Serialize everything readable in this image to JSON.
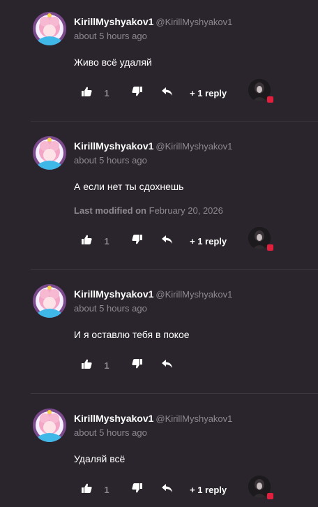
{
  "comments": [
    {
      "author": "KirillMyshyakov1",
      "handle": "@KirillMyshyakov1",
      "time": "about 5 hours ago",
      "text": "Живо всё удаляй",
      "likes": "1",
      "replies_label": "+ 1 reply"
    },
    {
      "author": "KirillMyshyakov1",
      "handle": "@KirillMyshyakov1",
      "time": "about 5 hours ago",
      "text": "А если нет ты сдохнешь",
      "modified_label": "Last modified on",
      "modified_date": "February 20, 2026",
      "likes": "1",
      "replies_label": "+ 1 reply"
    },
    {
      "author": "KirillMyshyakov1",
      "handle": "@KirillMyshyakov1",
      "time": "about 5 hours ago",
      "text": "И я оставлю тебя в покое",
      "likes": "1"
    },
    {
      "author": "KirillMyshyakov1",
      "handle": "@KirillMyshyakov1",
      "time": "about 5 hours ago",
      "text": "Удаляй всё",
      "likes": "1",
      "replies_label": "+ 1 reply"
    }
  ],
  "colors": {
    "background": "#2a252c",
    "muted_text": "#8e8892",
    "divider": "#3d3740",
    "notification_dot": "#e0203c"
  },
  "icons": [
    "thumbs-up-icon",
    "thumbs-down-icon",
    "reply-arrow-icon"
  ]
}
